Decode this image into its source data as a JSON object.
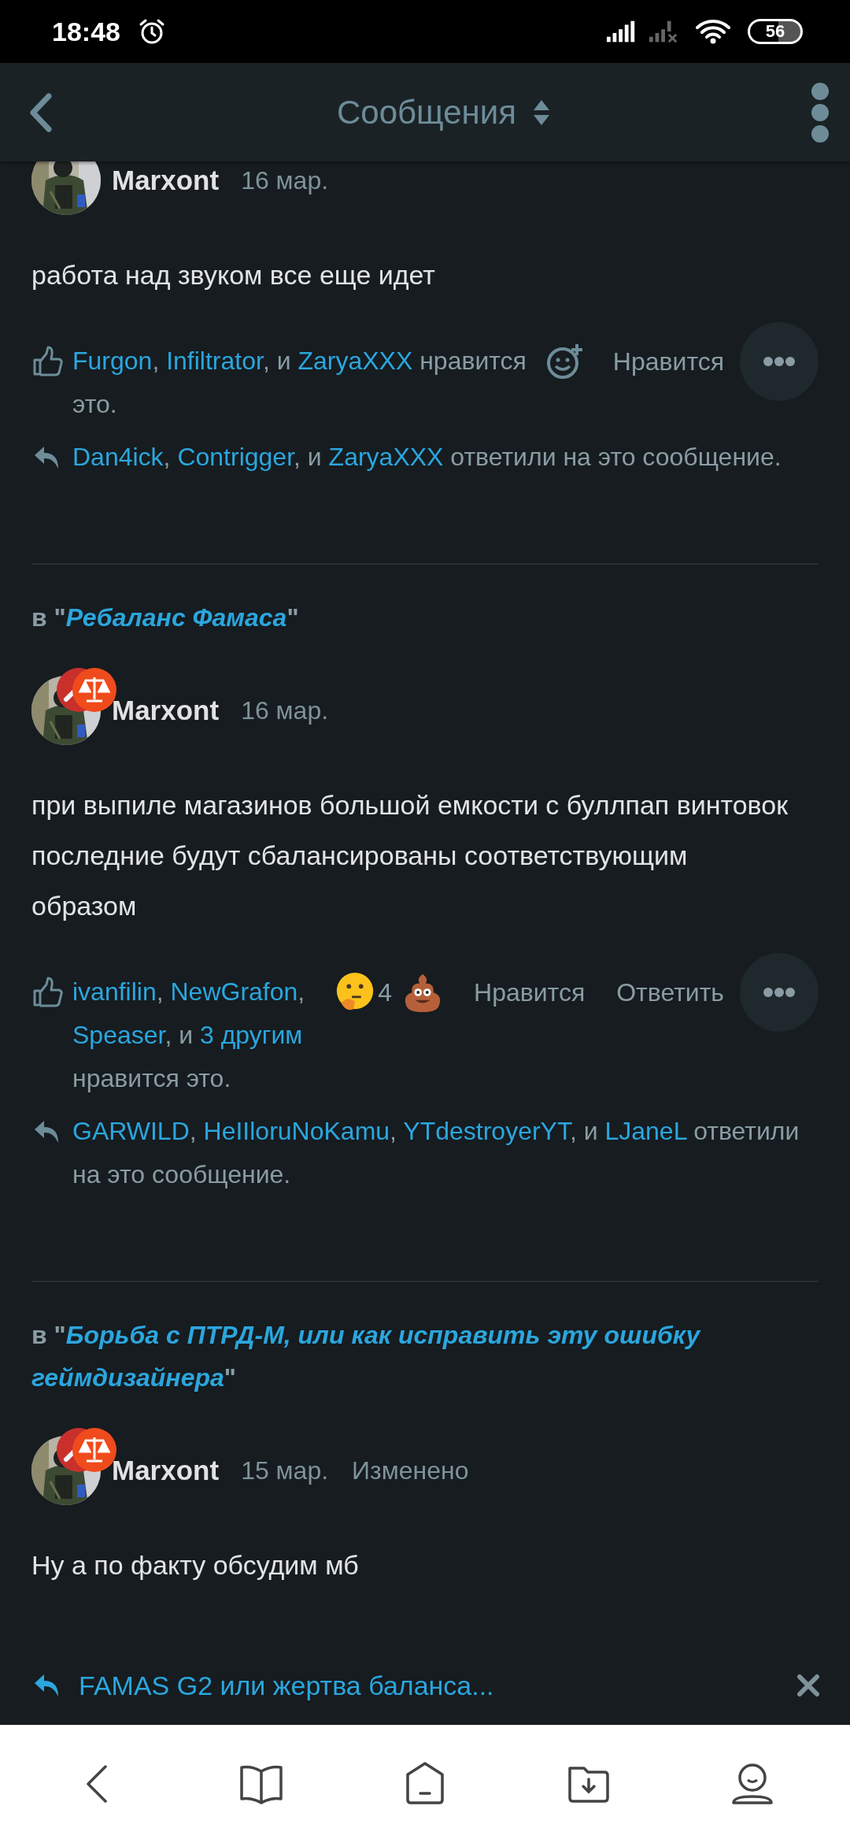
{
  "status_bar": {
    "time": "18:48",
    "battery": "56"
  },
  "app_bar": {
    "title": "Сообщения"
  },
  "posts": [
    {
      "author": "Marxont",
      "date": "16 мар.",
      "body": "работа над звуком все еще идет",
      "reactions": [
        {
          "kind": "add"
        }
      ],
      "buttons": [
        "Нравится"
      ],
      "likes": [
        {
          "text": "Furgon",
          "kind": "link"
        },
        {
          "text": ", ",
          "kind": "plain"
        },
        {
          "text": "Infiltrator",
          "kind": "link"
        },
        {
          "text": ", и ",
          "kind": "plain"
        },
        {
          "text": "ZaryaXXX",
          "kind": "link"
        },
        {
          "text": " нравится это.",
          "kind": "plain"
        }
      ],
      "replies": [
        {
          "text": "Dan4ick",
          "kind": "link"
        },
        {
          "text": ", ",
          "kind": "plain"
        },
        {
          "text": "Contrigger",
          "kind": "link"
        },
        {
          "text": ", и ",
          "kind": "plain"
        },
        {
          "text": "ZaryaXXX",
          "kind": "link"
        },
        {
          "text": " ответили на это сообщение.",
          "kind": "plain"
        }
      ]
    },
    {
      "thread": {
        "prefix": "в \"",
        "title": "Ребаланс Фамаса",
        "suffix": "\""
      },
      "author": "Marxont",
      "date": "16 мар.",
      "body": "при выпиле магазинов большой емкости с буллпап винтовок последние будут сбалансированы соответствующим образом",
      "reactions": [
        {
          "kind": "thinking",
          "count": "4"
        },
        {
          "kind": "poop"
        }
      ],
      "buttons": [
        "Нравится",
        "Ответить"
      ],
      "likes": [
        {
          "text": "ivanfilin",
          "kind": "link"
        },
        {
          "text": ", ",
          "kind": "plain"
        },
        {
          "text": "NewGrafon",
          "kind": "link"
        },
        {
          "text": ", ",
          "kind": "plain"
        },
        {
          "text": "Speaser",
          "kind": "link"
        },
        {
          "text": ", и ",
          "kind": "plain"
        },
        {
          "text": "3 другим",
          "kind": "link"
        },
        {
          "text": " нравится это.",
          "kind": "plain"
        }
      ],
      "replies": [
        {
          "text": "GARWILD",
          "kind": "link"
        },
        {
          "text": ", ",
          "kind": "plain"
        },
        {
          "text": "HeIIloruNoKamu",
          "kind": "link"
        },
        {
          "text": ", ",
          "kind": "plain"
        },
        {
          "text": "YTdestroyerYT",
          "kind": "link"
        },
        {
          "text": ", и ",
          "kind": "plain"
        },
        {
          "text": "LJaneL",
          "kind": "link"
        },
        {
          "text": " ответили на это сообщение.",
          "kind": "plain"
        }
      ]
    },
    {
      "thread": {
        "prefix": "в \"",
        "title": "Борьба с ПТРД-М, или как исправить эту ошибку геймдизайнера",
        "suffix": "\""
      },
      "author": "Marxont",
      "date": "15 мар.",
      "edited": "Изменено",
      "body": "Ну а по факту обсудим мб"
    }
  ],
  "reply_bar": {
    "text": "FAMAS G2 или жертва баланса..."
  }
}
